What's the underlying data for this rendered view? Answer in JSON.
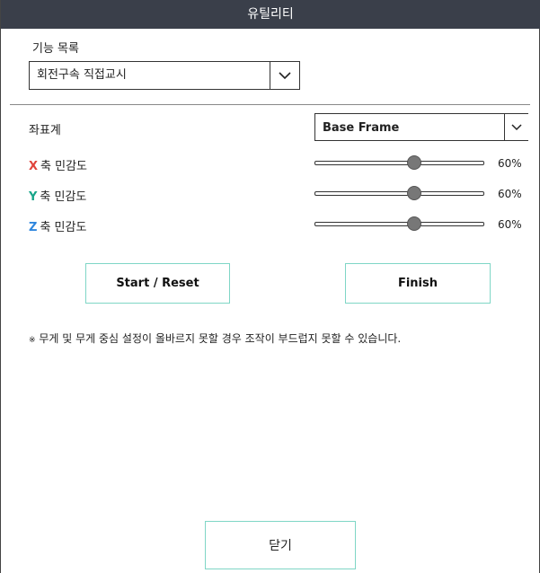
{
  "window": {
    "title": "유틸리티"
  },
  "function_list": {
    "label": "기능 목록",
    "selected": "회전구속 직접교시",
    "dropdown_icon": "chevron-down-icon"
  },
  "coordinate": {
    "label": "좌표계",
    "selected": "Base Frame",
    "dropdown_icon": "chevron-down-icon"
  },
  "sensitivity": [
    {
      "axis": "X",
      "axis_color": "#e0433a",
      "label": "축 민감도",
      "value": 0.6,
      "display": "60%"
    },
    {
      "axis": "Y",
      "axis_color": "#17a589",
      "label": "축 민감도",
      "value": 0.6,
      "display": "60%"
    },
    {
      "axis": "Z",
      "axis_color": "#2e86de",
      "label": "축 민감도",
      "value": 0.6,
      "display": "60%"
    }
  ],
  "buttons": {
    "start_reset": "Start / Reset",
    "finish": "Finish",
    "close": "닫기"
  },
  "note": {
    "symbol": "※",
    "text": "무게 및 무게 중심 설정이 올바르지 못할 경우 조작이 부드럽지 못할 수 있습니다."
  },
  "colors": {
    "titlebar": "#3a3f4a",
    "button_border": "#7fd6c6"
  }
}
